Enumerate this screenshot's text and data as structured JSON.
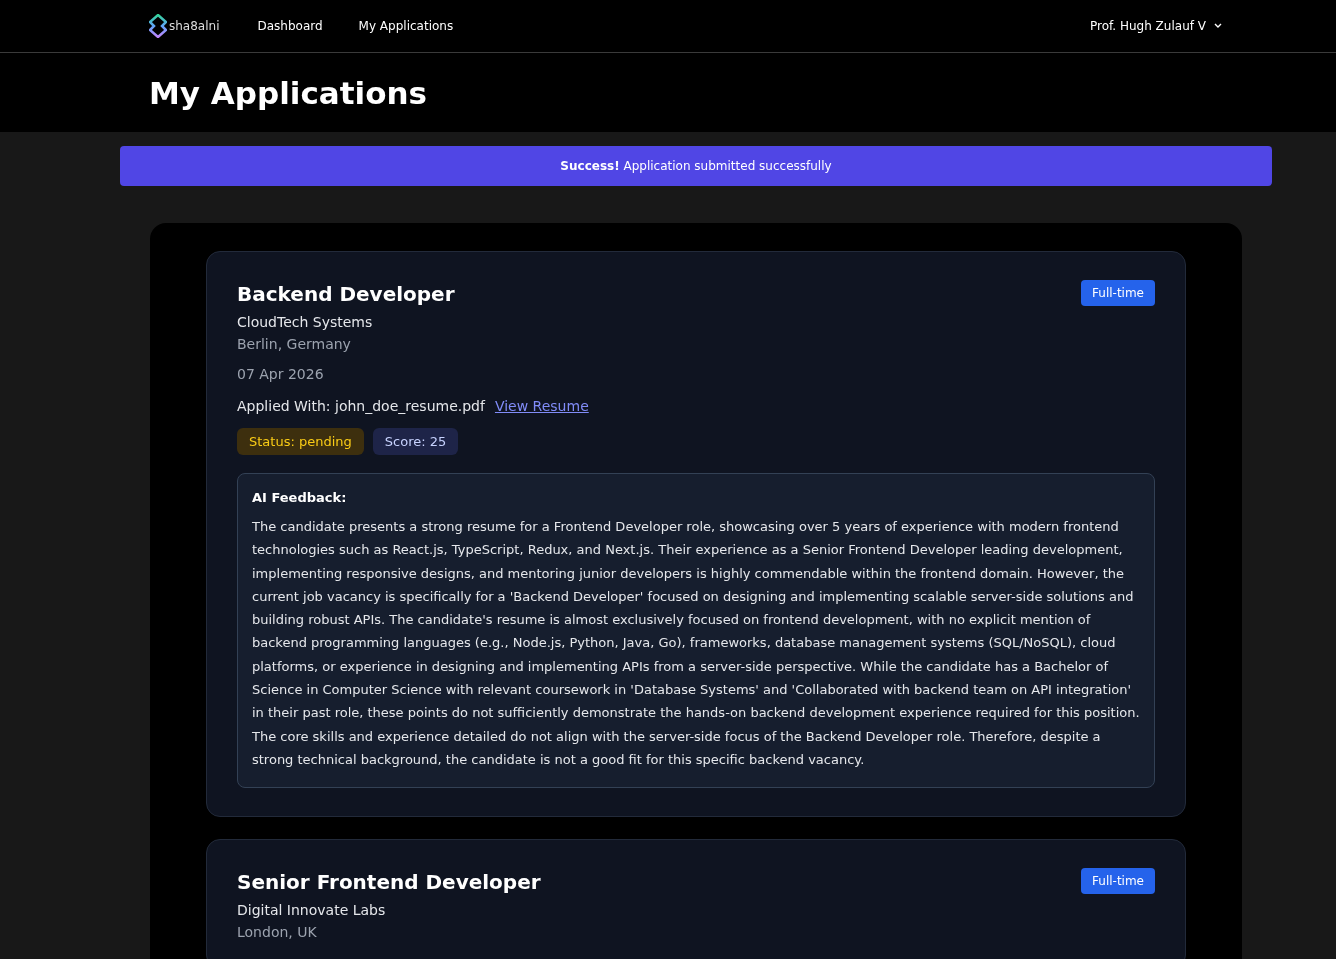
{
  "header": {
    "logo": "sha8alni",
    "nav": [
      {
        "label": "Dashboard",
        "selected": false
      },
      {
        "label": "My Applications",
        "selected": false
      }
    ],
    "user": "Prof. Hugh Zulauf V"
  },
  "page_title": "My Applications",
  "alert": {
    "text": "**Success!** Application submitted successfully"
  },
  "applications": [
    {
      "title": "Backend Developer",
      "company": "CloudTech Systems",
      "location": "Berlin, Germany",
      "type": "Full-time",
      "date": "07 Apr 2026",
      "applied_with": "Applied With: john_doe_resume.pdf",
      "resume_link": "View Resume",
      "status": "Status: pending",
      "score": "Score: 25",
      "feedback_label": "AI Feedback:",
      "feedback": "The candidate presents a strong resume for a Frontend Developer role, showcasing over 5 years of experience with modern frontend technologies such as React.js, TypeScript, Redux, and Next.js. Their experience as a Senior Frontend Developer leading development, implementing responsive designs, and mentoring junior developers is highly commendable within the frontend domain. However, the current job vacancy is specifically for a 'Backend Developer' focused on designing and implementing scalable server-side solutions and building robust APIs. The candidate's resume is almost exclusively focused on frontend development, with no explicit mention of backend programming languages (e.g., Node.js, Python, Java, Go), frameworks, database management systems (SQL/NoSQL), cloud platforms, or experience in designing and implementing APIs from a server-side perspective. While the candidate has a Bachelor of Science in Computer Science with relevant coursework in 'Database Systems' and 'Collaborated with backend team on API integration' in their past role, these points do not sufficiently demonstrate the hands-on backend development experience required for this position. The core skills and experience detailed do not align with the server-side focus of the Backend Developer role. Therefore, despite a strong technical background, the candidate is not a good fit for this specific backend vacancy."
    },
    {
      "title": "Senior Frontend Developer",
      "company": "Digital Innovate Labs",
      "location": "London, UK",
      "type": "Full-time"
    }
  ]
}
